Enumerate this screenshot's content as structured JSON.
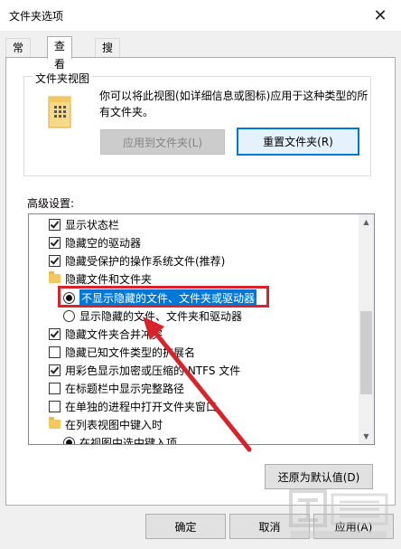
{
  "window": {
    "title": "文件夹选项",
    "close_glyph": "✕"
  },
  "tabs": [
    {
      "label": "常规",
      "active": false
    },
    {
      "label": "查看",
      "active": true
    },
    {
      "label": "搜索",
      "active": false
    }
  ],
  "folder_views": {
    "group_label": "文件夹视图",
    "description": "你可以将此视图(如详细信息或图标)应用于这种类型的所有文件夹。",
    "apply_button": "应用到文件夹(L)",
    "reset_button": "重置文件夹(R)"
  },
  "advanced": {
    "label": "高级设置:",
    "items": [
      {
        "type": "checkbox",
        "checked": true,
        "label": "显示状态栏"
      },
      {
        "type": "checkbox",
        "checked": true,
        "label": "隐藏空的驱动器"
      },
      {
        "type": "checkbox",
        "checked": true,
        "label": "隐藏受保护的操作系统文件(推荐)"
      },
      {
        "type": "folder",
        "label": "隐藏文件和文件夹"
      },
      {
        "type": "radio",
        "checked": true,
        "label": "不显示隐藏的文件、文件夹或驱动器",
        "selected": true
      },
      {
        "type": "radio",
        "checked": false,
        "label": "显示隐藏的文件、文件夹和驱动器"
      },
      {
        "type": "checkbox",
        "checked": true,
        "label": "隐藏文件夹合并冲突"
      },
      {
        "type": "checkbox",
        "checked": false,
        "label": "隐藏已知文件类型的扩展名"
      },
      {
        "type": "checkbox",
        "checked": true,
        "label": "用彩色显示加密或压缩的 NTFS 文件"
      },
      {
        "type": "checkbox",
        "checked": false,
        "label": "在标题栏中显示完整路径"
      },
      {
        "type": "checkbox",
        "checked": false,
        "label": "在单独的进程中打开文件夹窗口"
      },
      {
        "type": "folder",
        "label": "在列表视图中键入时"
      },
      {
        "type": "radio",
        "checked": true,
        "label": "在视图中选中键入项"
      }
    ],
    "restore_button": "还原为默认值(D)"
  },
  "footer": {
    "ok": "确定",
    "cancel": "取消",
    "apply": "应用(A)"
  },
  "colors": {
    "selection": "#0078d7",
    "annotation": "#d9232b"
  }
}
